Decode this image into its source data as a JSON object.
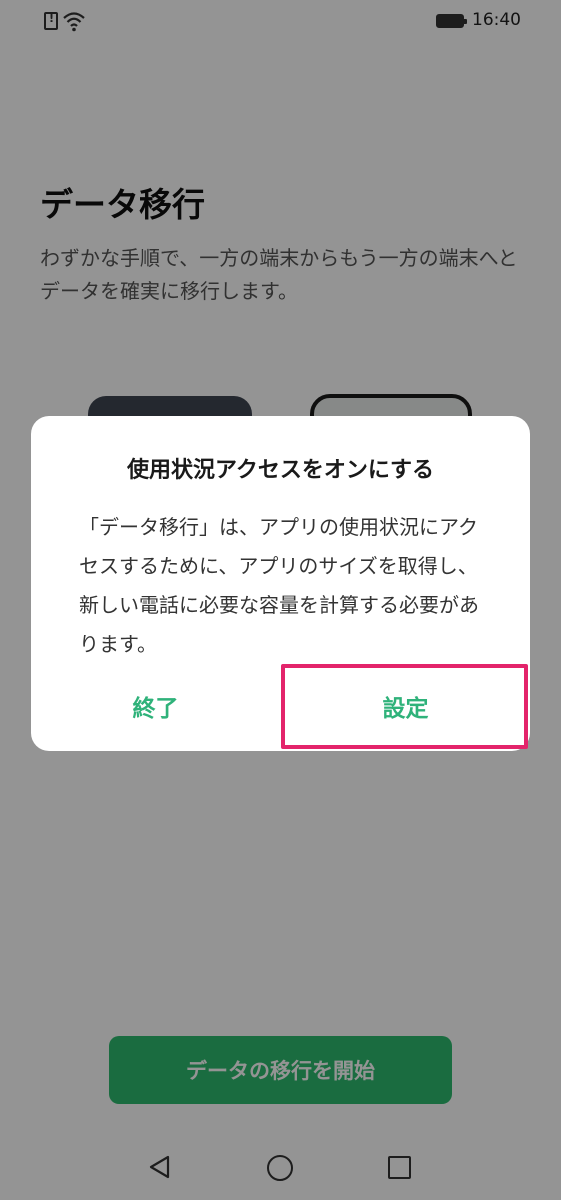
{
  "status_bar": {
    "time": "16:40",
    "icons": [
      "sim-alert-icon",
      "wifi-icon",
      "battery-icon"
    ]
  },
  "page": {
    "title": "データ移行",
    "description": "わずかな手順で、一方の端末からもう一方の端末へとデータを確実に移行します。",
    "start_button_label": "データの移行を開始"
  },
  "dialog": {
    "title": "使用状況アクセスをオンにする",
    "message": "「データ移行」は、アプリの使用状況にアクセスするために、アプリのサイズを取得し、新しい電話に必要な容量を計算する必要があります。",
    "quit_label": "終了",
    "settings_label": "設定"
  },
  "nav_bar": {
    "icons": [
      "back-icon",
      "home-icon",
      "recent-apps-icon"
    ]
  },
  "colors": {
    "accent_green": "#2fb27a",
    "start_button_green": "#2dbb6e",
    "highlight_magenta": "#e3246b"
  }
}
